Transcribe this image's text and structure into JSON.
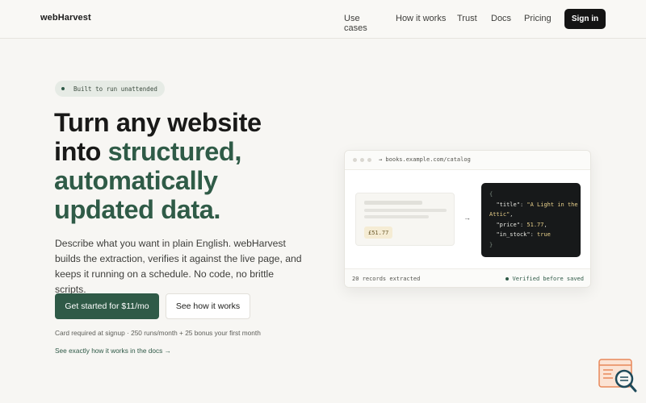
{
  "nav": {
    "brand": "webHarvest",
    "links": [
      "Use cases",
      "How it works",
      "Trust",
      "Docs",
      "Pricing"
    ],
    "signin": "Sign in"
  },
  "hero": {
    "pill": "Built to run unattended",
    "headline_plain": "Turn any website into ",
    "headline_accent": "structured, automatically updated data.",
    "lede": "Describe what you want in plain English. webHarvest builds the extraction, verifies it against the live page, and keeps it running on a schedule. No code, no brittle scripts.",
    "cta_primary": "Get started for $11/mo",
    "cta_secondary": "See how it works",
    "fineprint": "Card required at signup · 250 runs/month + 25 bonus your first month",
    "docs_link": "See exactly how it works in the docs →"
  },
  "demo": {
    "url": "→ books.example.com/catalog",
    "price": "£51.77",
    "arrow": "→",
    "json": {
      "open": "{",
      "title_key": "\"title\"",
      "title_val": "\"A Light in the Attic\"",
      "price_key": "\"price\"",
      "price_val": "51.77",
      "stock_key": "\"in_stock\"",
      "stock_val": "true",
      "close": "}"
    },
    "records": "20 records extracted",
    "verified": "Verified before saved"
  },
  "colors": {
    "accent": "#2f5a47",
    "dark": "#141414",
    "background": "#f7f6f3"
  }
}
